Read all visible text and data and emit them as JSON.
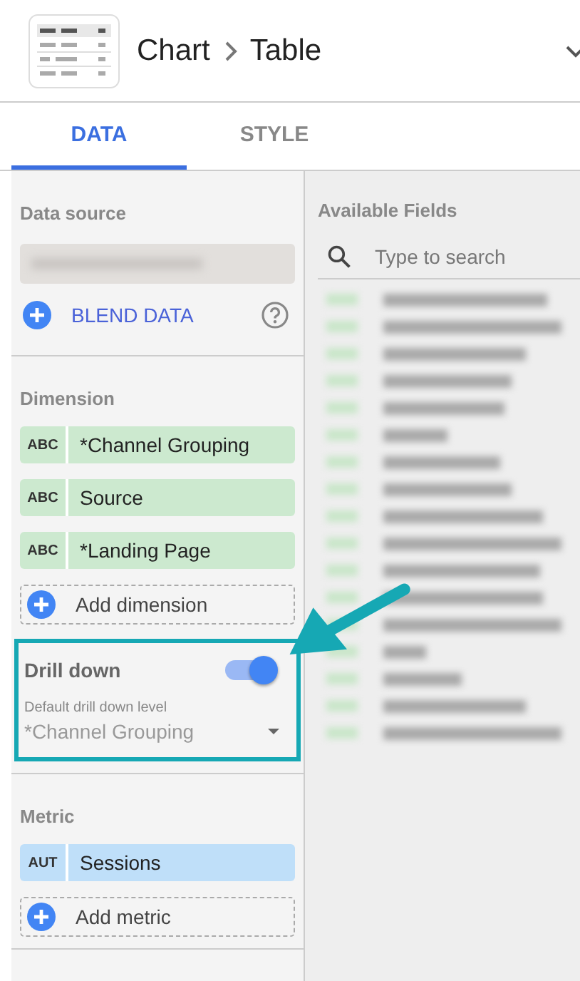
{
  "header": {
    "title": "Chart",
    "subtitle": "Table"
  },
  "tabs": [
    {
      "label": "DATA",
      "selected": true
    },
    {
      "label": "STYLE",
      "selected": false
    }
  ],
  "data_source": {
    "heading": "Data source",
    "blend_label": "BLEND DATA"
  },
  "dimension": {
    "heading": "Dimension",
    "chips": [
      {
        "type": "ABC",
        "label": "*Channel Grouping"
      },
      {
        "type": "ABC",
        "label": "Source"
      },
      {
        "type": "ABC",
        "label": "*Landing Page"
      }
    ],
    "add_label": "Add dimension"
  },
  "drill_down": {
    "label": "Drill down",
    "on": true,
    "level_label": "Default drill down level",
    "level_value": "*Channel Grouping"
  },
  "metric": {
    "heading": "Metric",
    "chips": [
      {
        "type": "AUT",
        "label": "Sessions"
      }
    ],
    "add_label": "Add metric"
  },
  "available_fields": {
    "heading": "Available Fields",
    "search": {
      "placeholder": "Type to search"
    }
  }
}
